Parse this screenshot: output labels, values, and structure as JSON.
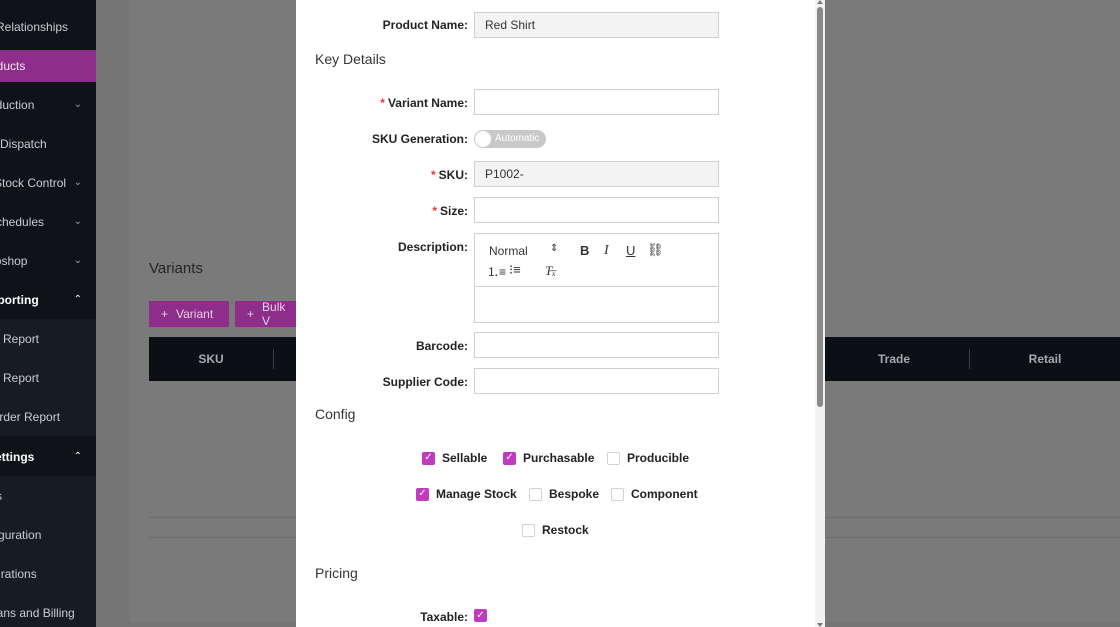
{
  "sidebar": {
    "items": [
      {
        "label": "Relationships",
        "chevron": ""
      },
      {
        "label": "Products",
        "chevron": ""
      },
      {
        "label": "Production",
        "chevron": "⌄"
      },
      {
        "label": "Dispatch",
        "chevron": ""
      },
      {
        "label": "Stock Control",
        "chevron": "⌄"
      },
      {
        "label": "Schedules",
        "chevron": "⌄"
      },
      {
        "label": "Webshop",
        "chevron": "⌄"
      },
      {
        "label": "Reporting",
        "chevron": "⌃"
      },
      {
        "label": "Report",
        "chevron": ""
      },
      {
        "label": "Report",
        "chevron": ""
      },
      {
        "label": "Order Report",
        "chevron": ""
      },
      {
        "label": "Settings",
        "chevron": "⌃"
      },
      {
        "label": "s",
        "chevron": ""
      },
      {
        "label": "Configuration",
        "chevron": ""
      },
      {
        "label": "Integrations",
        "chevron": ""
      },
      {
        "label": "Plans and Billing",
        "chevron": ""
      }
    ]
  },
  "variants": {
    "title": "Variants",
    "add_variant": "Variant",
    "bulk_variant": "Bulk V",
    "columns": [
      "SKU",
      "Trade",
      "Retail"
    ]
  },
  "modal": {
    "product_name_label": "Product Name",
    "product_name_value": "Red Shirt",
    "key_details_title": "Key Details",
    "variant_name_label": "Variant Name",
    "variant_name_value": "",
    "sku_generation_label": "SKU Generation",
    "sku_generation_toggle": "Automatic",
    "sku_label": "SKU",
    "sku_value": "P1002-",
    "size_label": "Size",
    "size_value": "",
    "description_label": "Description",
    "editor": {
      "format": "Normal",
      "bold": "B",
      "italic": "I",
      "underline": "U"
    },
    "barcode_label": "Barcode",
    "barcode_value": "",
    "supplier_code_label": "Supplier Code",
    "supplier_code_value": "",
    "config_title": "Config",
    "checkboxes": [
      {
        "label": "Sellable",
        "checked": true
      },
      {
        "label": "Purchasable",
        "checked": true
      },
      {
        "label": "Producible",
        "checked": false
      },
      {
        "label": "Manage Stock",
        "checked": true
      },
      {
        "label": "Bespoke",
        "checked": false
      },
      {
        "label": "Component",
        "checked": false
      },
      {
        "label": "Restock",
        "checked": false
      }
    ],
    "pricing_title": "Pricing",
    "taxable_label": "Taxable",
    "taxable_checked": true
  },
  "colors": {
    "accent": "#c13bbf",
    "sidebar_active": "#8e2d8a",
    "required": "#e53935"
  }
}
